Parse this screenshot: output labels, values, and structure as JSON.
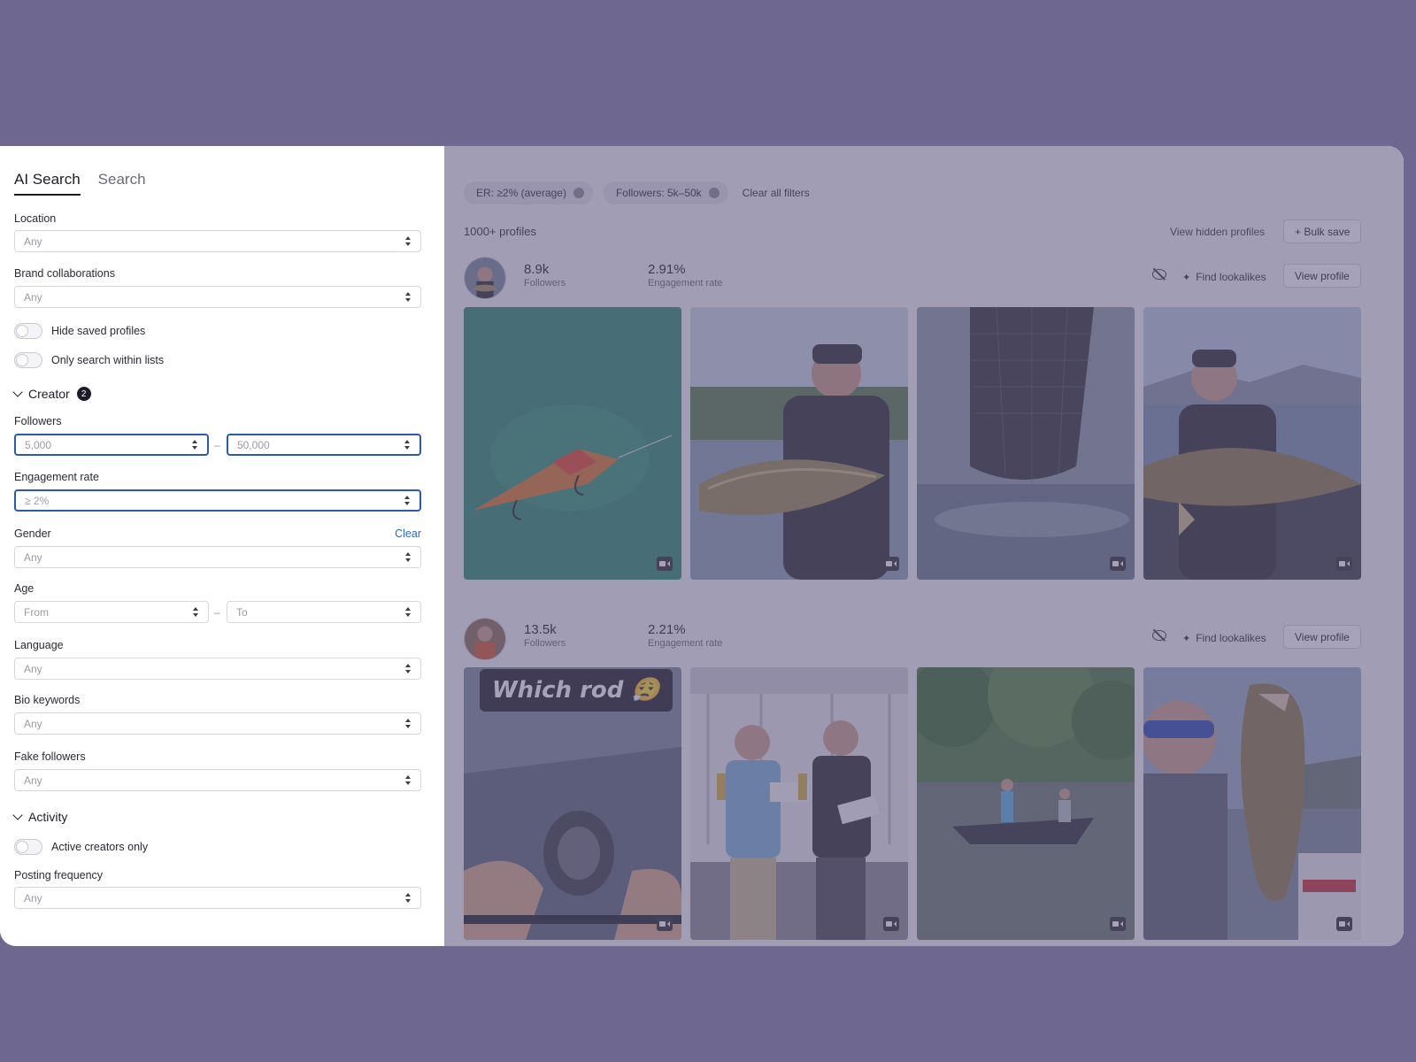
{
  "tabs": [
    {
      "label": "AI Search"
    },
    {
      "label": "Search"
    }
  ],
  "filters": {
    "location": {
      "label": "Location",
      "value": "Any"
    },
    "brand": {
      "label": "Brand collaborations",
      "value": "Any"
    },
    "hide_saved": "Hide saved profiles",
    "only_lists": "Only search within lists",
    "creator_section": {
      "label": "Creator",
      "badge": "2"
    },
    "followers": {
      "label": "Followers",
      "min": "5,000",
      "max": "50,000"
    },
    "engagement": {
      "label": "Engagement rate",
      "value": "≥ 2%"
    },
    "gender": {
      "label": "Gender",
      "clear": "Clear",
      "value": "Any"
    },
    "age": {
      "label": "Age",
      "from": "From",
      "to": "To"
    },
    "language": {
      "label": "Language",
      "value": "Any"
    },
    "bio": {
      "label": "Bio keywords",
      "value": "Any"
    },
    "fake": {
      "label": "Fake followers",
      "value": "Any"
    },
    "activity_section": {
      "label": "Activity"
    },
    "active_only": "Active creators only",
    "posting": {
      "label": "Posting frequency",
      "value": "Any"
    }
  },
  "results": {
    "chips": [
      {
        "label": "ER: ≥2% (average)"
      },
      {
        "label": "Followers: 5k–50k"
      }
    ],
    "clear_all": "Clear all filters",
    "count": "1000+ profiles",
    "view_hidden": "View hidden profiles",
    "bulk_save": "+ Bulk save",
    "find_lookalikes": "Find lookalikes",
    "view_profile": "View profile",
    "profiles": [
      {
        "followers": "8.9k",
        "followers_label": "Followers",
        "er": "2.91%",
        "er_label": "Engagement rate"
      },
      {
        "followers": "13.5k",
        "followers_label": "Followers",
        "er": "2.21%",
        "er_label": "Engagement rate",
        "post_caption": "Which rod 😮‍💨"
      }
    ]
  },
  "colors": {
    "background": "#6e6790",
    "accent": "#2d5aa8",
    "link": "#2a68c9"
  }
}
